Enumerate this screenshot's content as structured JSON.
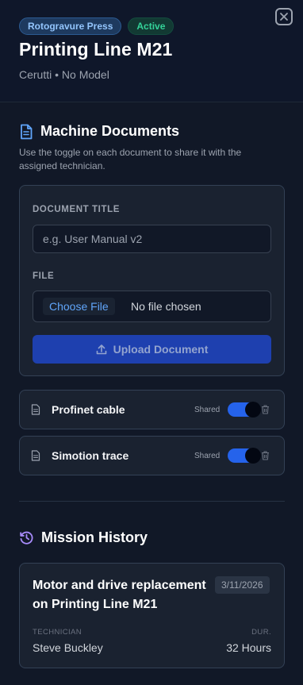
{
  "header": {
    "type_badge": "Rotogravure Press",
    "status_badge": "Active",
    "title": "Printing Line M21",
    "subtitle": "Cerutti • No Model"
  },
  "documents": {
    "section_title": "Machine Documents",
    "hint": "Use the toggle on each document to share it with the assigned technician.",
    "form": {
      "title_label": "DOCUMENT TITLE",
      "title_value": "",
      "title_placeholder": "e.g. User Manual v2",
      "file_label": "FILE",
      "choose_file_label": "Choose File",
      "no_file_text": "No file chosen",
      "upload_label": "Upload Document"
    },
    "items": [
      {
        "name": "Profinet cable",
        "shared_label": "Shared",
        "shared": true
      },
      {
        "name": "Simotion trace",
        "shared_label": "Shared",
        "shared": true
      }
    ]
  },
  "history": {
    "section_title": "Mission History",
    "missions": [
      {
        "title": "Motor and drive replacement on Printing Line M21",
        "date": "3/11/2026",
        "technician_label": "TECHNICIAN",
        "technician": "Steve Buckley",
        "duration_label": "DUR.",
        "duration": "32 Hours"
      }
    ]
  },
  "colors": {
    "background": "#111827",
    "accent": "#2563eb",
    "status_green": "#34d399",
    "history_icon": "#a78bfa",
    "documents_icon": "#60a5fa"
  },
  "icons": {
    "close": "close-icon",
    "documents": "document-icon",
    "upload": "upload-icon",
    "file": "file-icon",
    "trash": "trash-icon",
    "history": "history-icon"
  }
}
